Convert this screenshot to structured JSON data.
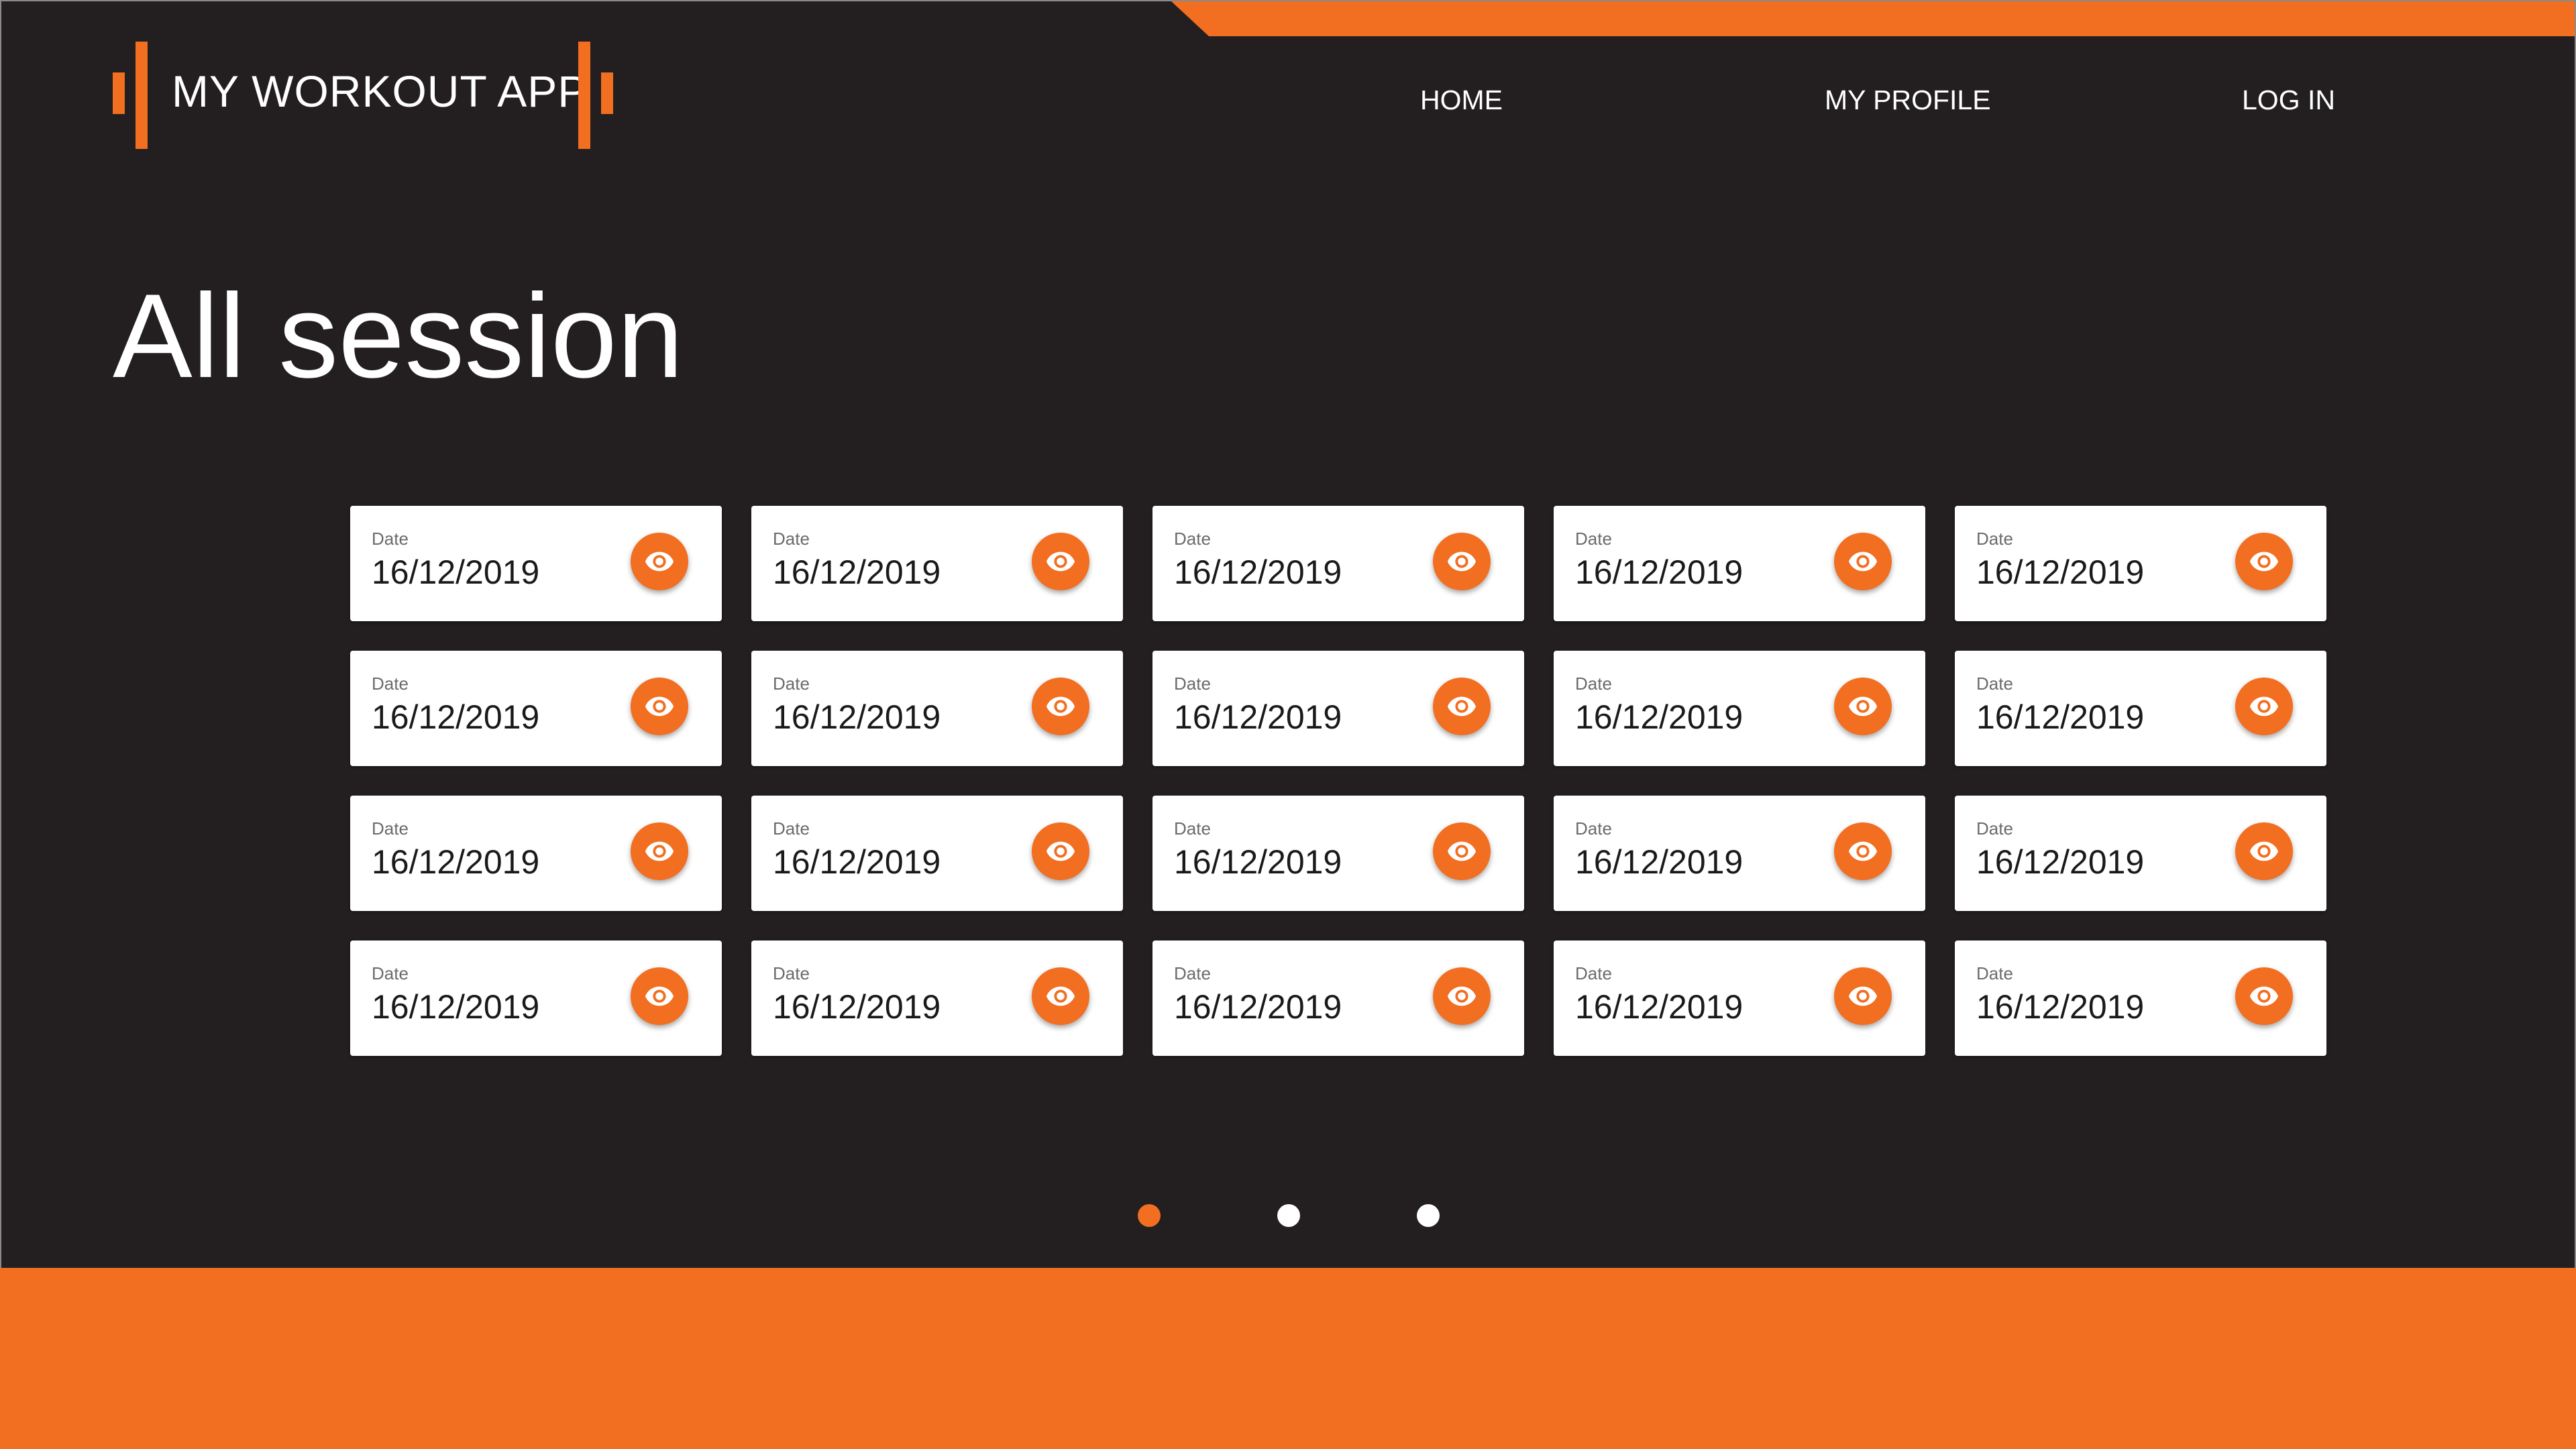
{
  "app": {
    "name": "MY WORKOUT APP"
  },
  "nav": {
    "home": "HOME",
    "profile": "MY PROFILE",
    "login": "LOG IN"
  },
  "page": {
    "title": "All session"
  },
  "sessions": [
    {
      "label": "Date",
      "value": "16/12/2019",
      "icon": "eye-icon"
    },
    {
      "label": "Date",
      "value": "16/12/2019",
      "icon": "eye-icon"
    },
    {
      "label": "Date",
      "value": "16/12/2019",
      "icon": "eye-icon"
    },
    {
      "label": "Date",
      "value": "16/12/2019",
      "icon": "eye-icon"
    },
    {
      "label": "Date",
      "value": "16/12/2019",
      "icon": "eye-icon"
    },
    {
      "label": "Date",
      "value": "16/12/2019",
      "icon": "eye-icon"
    },
    {
      "label": "Date",
      "value": "16/12/2019",
      "icon": "eye-icon"
    },
    {
      "label": "Date",
      "value": "16/12/2019",
      "icon": "eye-icon"
    },
    {
      "label": "Date",
      "value": "16/12/2019",
      "icon": "eye-icon"
    },
    {
      "label": "Date",
      "value": "16/12/2019",
      "icon": "eye-icon"
    },
    {
      "label": "Date",
      "value": "16/12/2019",
      "icon": "eye-icon"
    },
    {
      "label": "Date",
      "value": "16/12/2019",
      "icon": "eye-icon"
    },
    {
      "label": "Date",
      "value": "16/12/2019",
      "icon": "eye-icon"
    },
    {
      "label": "Date",
      "value": "16/12/2019",
      "icon": "eye-icon"
    },
    {
      "label": "Date",
      "value": "16/12/2019",
      "icon": "eye-icon"
    },
    {
      "label": "Date",
      "value": "16/12/2019",
      "icon": "eye-icon"
    },
    {
      "label": "Date",
      "value": "16/12/2019",
      "icon": "eye-icon"
    },
    {
      "label": "Date",
      "value": "16/12/2019",
      "icon": "eye-icon"
    },
    {
      "label": "Date",
      "value": "16/12/2019",
      "icon": "eye-icon"
    },
    {
      "label": "Date",
      "value": "16/12/2019",
      "icon": "eye-icon"
    }
  ],
  "pagination": {
    "pages": 3,
    "current": 1
  },
  "colors": {
    "accent": "#f26e20",
    "background": "#231f20",
    "card": "#ffffff",
    "text_light": "#ffffff"
  }
}
